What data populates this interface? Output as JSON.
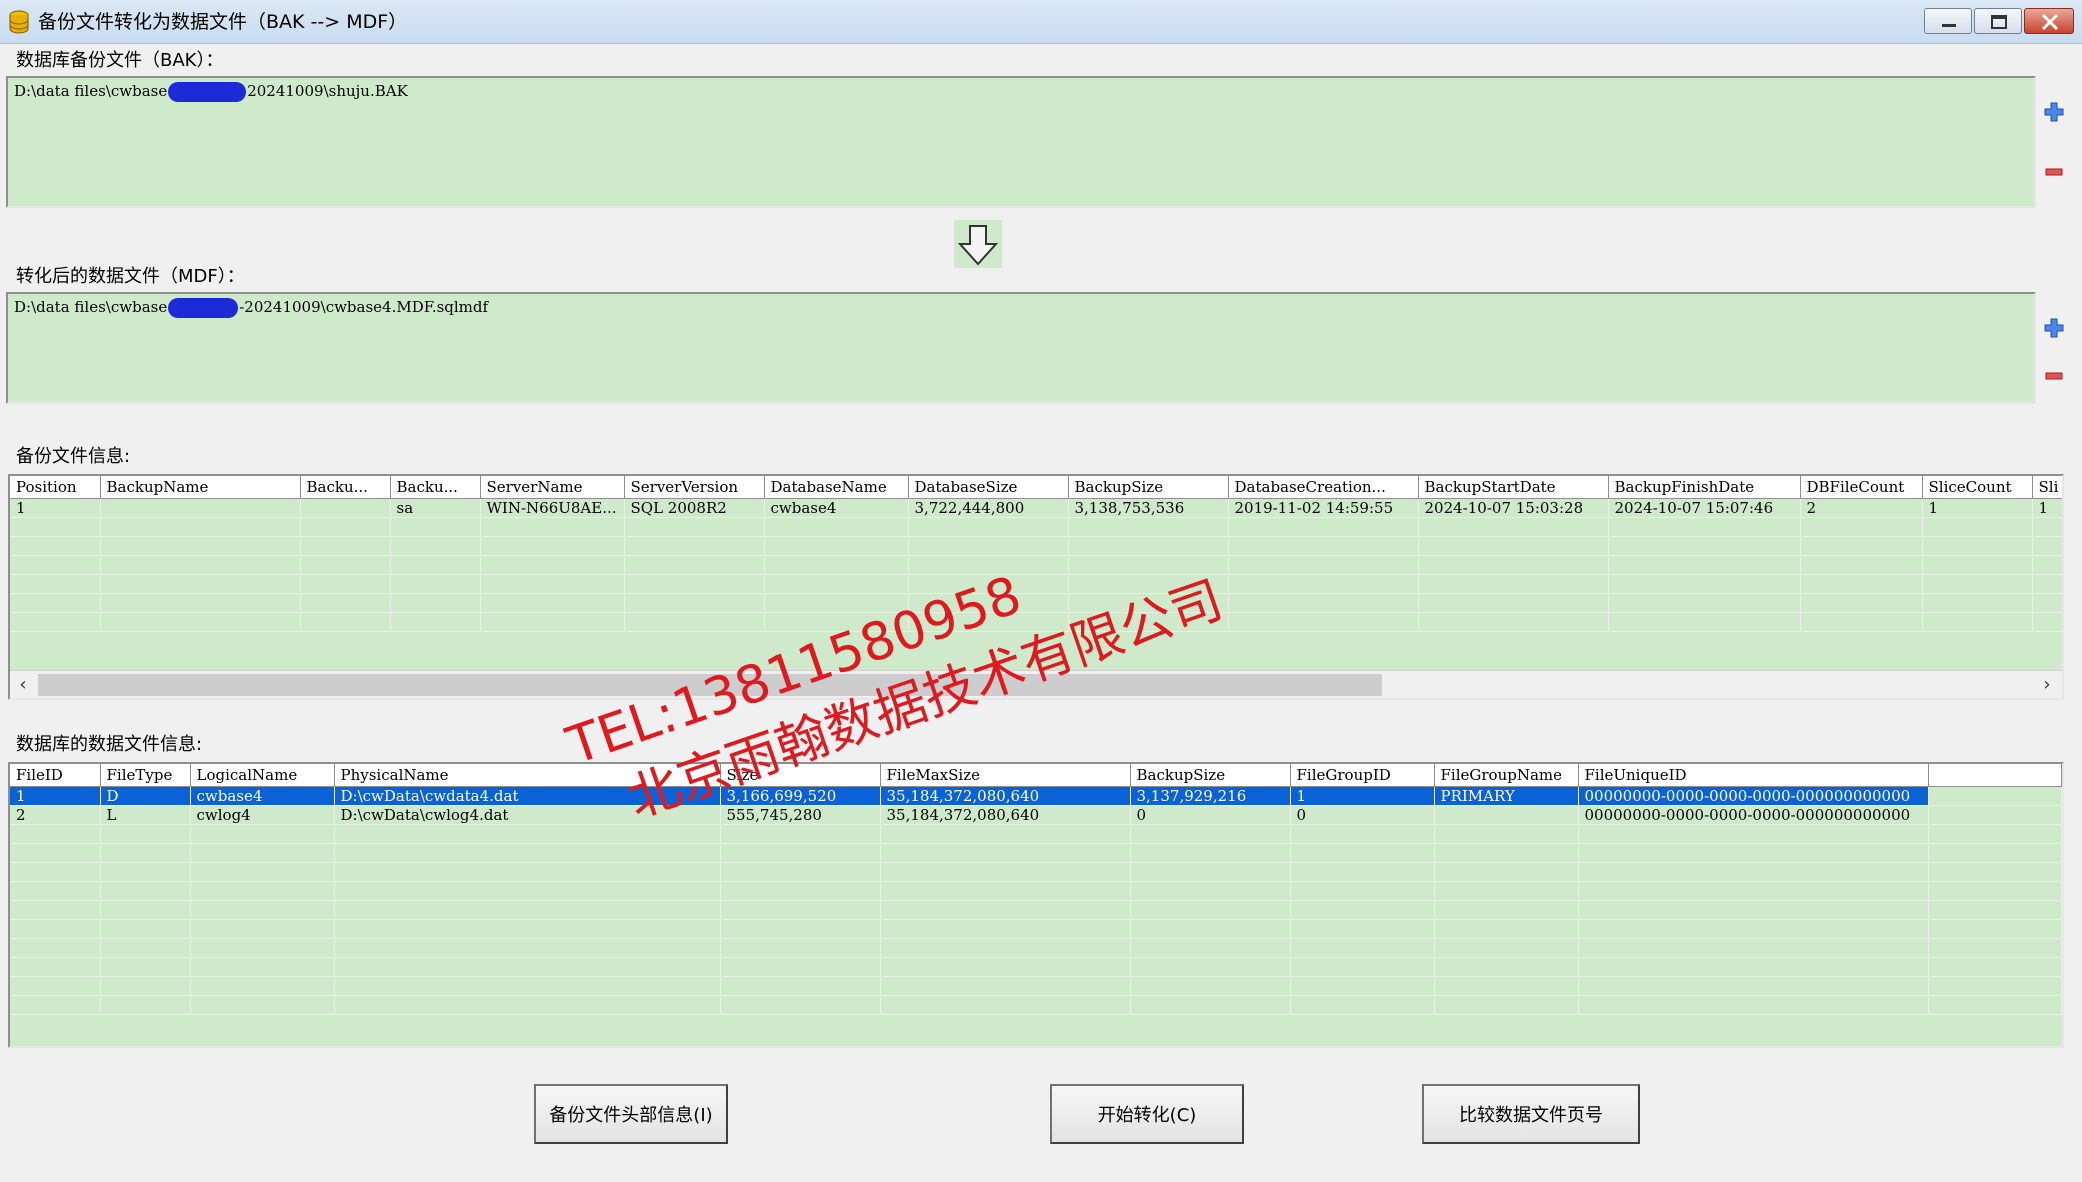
{
  "window": {
    "title": "备份文件转化为数据文件（BAK --> MDF）",
    "icon": "database-icon"
  },
  "bak": {
    "label": "数据库备份文件（BAK）：",
    "path_prefix": "D:\\data files\\cwbase",
    "path_suffix": "20241009\\shuju.BAK"
  },
  "mdf": {
    "label": "转化后的数据文件（MDF）：",
    "path_prefix": "D:\\data files\\cwbase",
    "path_suffix": "-20241009\\cwbase4.MDF.sqlmdf"
  },
  "convert_arrow_icon": "down-arrow-icon",
  "backup_info": {
    "label": "备份文件信息:",
    "columns": [
      "Position",
      "BackupName",
      "Backu...",
      "Backu...",
      "ServerName",
      "ServerVersion",
      "DatabaseName",
      "DatabaseSize",
      "BackupSize",
      "DatabaseCreation...",
      "BackupStartDate",
      "BackupFinishDate",
      "DBFileCount",
      "SliceCount",
      "Sli"
    ],
    "rows": [
      [
        "1",
        "",
        "",
        "sa",
        "WIN-N66U8AE...",
        "SQL 2008R2",
        "cwbase4",
        "3,722,444,800",
        "3,138,753,536",
        "2019-11-02 14:59:55",
        "2024-10-07 15:03:28",
        "2024-10-07 15:07:46",
        "2",
        "1",
        "1"
      ]
    ]
  },
  "file_info": {
    "label": "数据库的数据文件信息:",
    "columns": [
      "FileID",
      "FileType",
      "LogicalName",
      "PhysicalName",
      "Size",
      "FileMaxSize",
      "BackupSize",
      "FileGroupID",
      "FileGroupName",
      "FileUniqueID"
    ],
    "rows": [
      [
        "1",
        "D",
        "cwbase4",
        "D:\\cwData\\cwdata4.dat",
        "3,166,699,520",
        "35,184,372,080,640",
        "3,137,929,216",
        "1",
        "PRIMARY",
        "00000000-0000-0000-0000-000000000000"
      ],
      [
        "2",
        "L",
        "cwlog4",
        "D:\\cwData\\cwlog4.dat",
        "555,745,280",
        "35,184,372,080,640",
        "0",
        "0",
        "",
        "00000000-0000-0000-0000-000000000000"
      ]
    ],
    "selected_row": 0
  },
  "buttons": {
    "header_info": "备份文件头部信息(I)",
    "start": "开始转化(C)",
    "compare": "比较数据文件页号"
  },
  "watermark": {
    "line1": "TEL:13811580958",
    "line2": "北京雨翰数据技术有限公司"
  },
  "colors": {
    "panel_green": "#cfe9cb",
    "selection_blue": "#0a62d6",
    "watermark_red": "#e0191e"
  }
}
